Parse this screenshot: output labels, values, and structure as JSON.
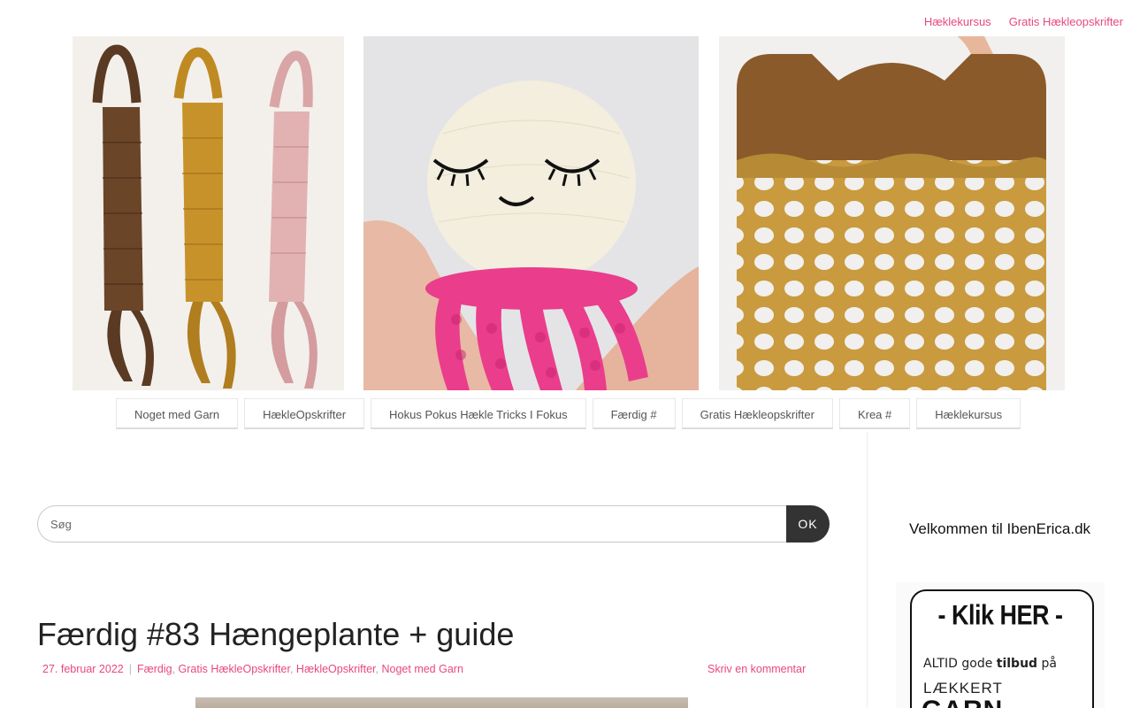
{
  "top_links": [
    "Hæklekursus",
    "Gratis Hækleopskrifter"
  ],
  "hero": {
    "images": [
      {
        "name": "Hæklede hængeplanter brun, gul og rosa"
      },
      {
        "name": "Hæklet vandmand med pink tentakler"
      },
      {
        "name": "Hæklet net-taske i karamel"
      }
    ]
  },
  "main_nav": [
    "Noget med Garn",
    "HækleOpskrifter",
    "Hokus Pokus Hækle Tricks I Fokus",
    "Færdig #",
    "Gratis Hækleopskrifter",
    "Krea #",
    "Hæklekursus"
  ],
  "search": {
    "placeholder": "Søg",
    "button_label": "OK"
  },
  "post": {
    "title": "Færdig #83 Hængeplante + guide",
    "date": "27. februar 2022",
    "separator": "|",
    "categories": [
      "Færdig",
      "Gratis HækleOpskrifter",
      "HækleOpskrifter",
      "Noget med Garn"
    ],
    "comment_link": "Skriv en kommentar"
  },
  "sidebar": {
    "widget_title": "Velkommen til IbenErica.dk",
    "ad": {
      "headline": "- Klik HER -",
      "line1_normal": "ALTID gode ",
      "line1_bold": "tilbud",
      "line1_end": " på",
      "line2": "LÆKKERT",
      "line3": "GARN"
    }
  },
  "colors": {
    "accent": "#e8487f",
    "button": "#333333",
    "text": "#222222"
  }
}
